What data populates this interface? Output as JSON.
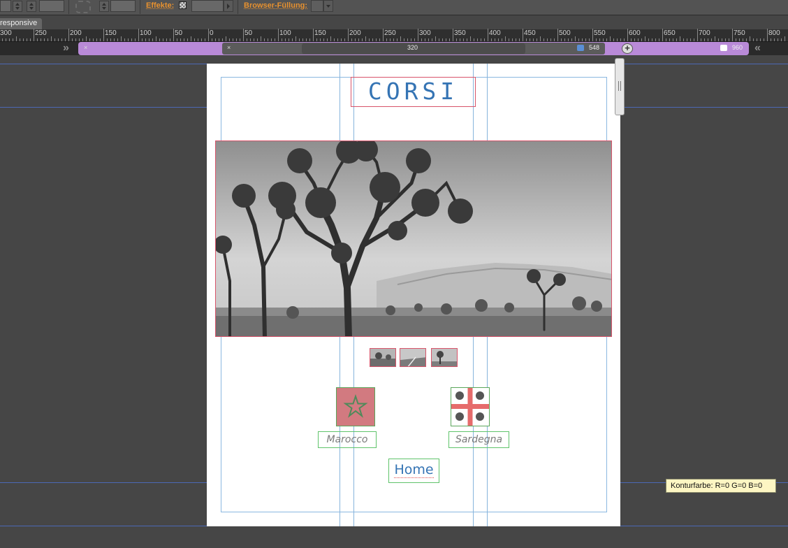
{
  "toolbar": {
    "effects_label": "Effekte:",
    "browser_fill_label": "Browser-Füllung:"
  },
  "tab": {
    "label": "responsive"
  },
  "ruler": {
    "labels": [
      "300",
      "250",
      "200",
      "150",
      "100",
      "50",
      "0",
      "50",
      "100",
      "150",
      "200",
      "250",
      "300",
      "350",
      "400",
      "450",
      "500",
      "550",
      "600",
      "650",
      "700",
      "750",
      "800"
    ]
  },
  "breakpoints": {
    "value_320": "320",
    "value_548": "548",
    "value_960": "960",
    "colors": {
      "breakpoint_bar": "#b98ad8"
    }
  },
  "page": {
    "title": "CORSI",
    "cards": [
      {
        "label": "Marocco",
        "flag": "morocco-flag"
      },
      {
        "label": "Sardegna",
        "flag": "sardinia-flag"
      }
    ],
    "home_link": "Home",
    "colors": {
      "accent": "#3574b4",
      "frame_red": "#d8546a",
      "frame_green": "#5fc36a"
    }
  },
  "tooltip": {
    "text": "Konturfarbe: R=0 G=0 B=0"
  }
}
